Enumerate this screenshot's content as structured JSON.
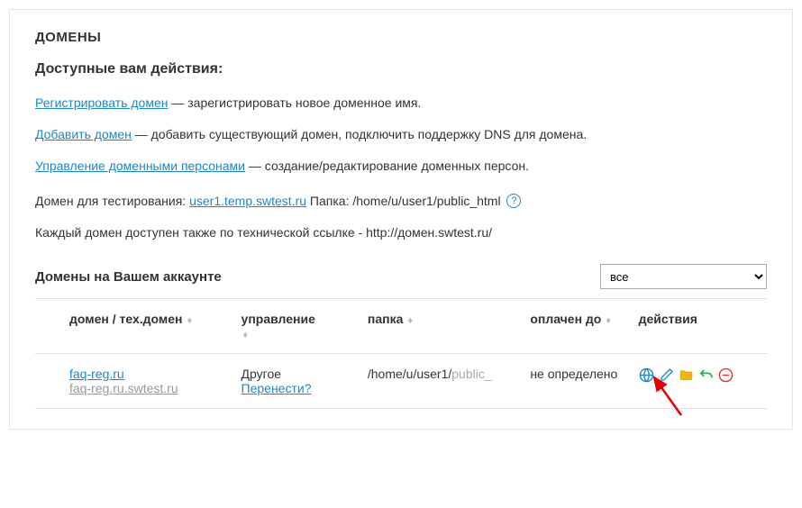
{
  "page_title": "ДОМЕНЫ",
  "subtitle": "Доступные вам действия:",
  "actions": {
    "register": {
      "link": "Регистрировать домен",
      "desc": " — зарегистрировать новое доменное имя."
    },
    "add": {
      "link": "Добавить домен",
      "desc": " — добавить существующий домен, подключить поддержку DNS для домена."
    },
    "persons": {
      "link": "Управление доменными персонами",
      "desc": " — создание/редактирование доменных персон."
    }
  },
  "test_domain": {
    "prefix": "Домен для тестирования: ",
    "link": "user1.temp.swtest.ru",
    "folder_label": " Папка: /home/u/user1/public_html "
  },
  "tech_link_note": "Каждый домен доступен также по технической ссылке - http://домен.swtest.ru/",
  "table_title": "Домены на Вашем аккаунте",
  "filter_value": "все",
  "columns": {
    "domain": "домен / тех.домен",
    "manage": "управление",
    "folder": "папка",
    "paid": "оплачен до",
    "actions": "действия"
  },
  "rows": [
    {
      "domain": "faq-reg.ru",
      "tech_domain": "faq-reg.ru.swtest.ru",
      "manage_text": "Другое",
      "manage_link": "Перенести?",
      "folder_prefix": "/home/u/user1/",
      "folder_grey": "public_",
      "paid": "не определено"
    }
  ]
}
